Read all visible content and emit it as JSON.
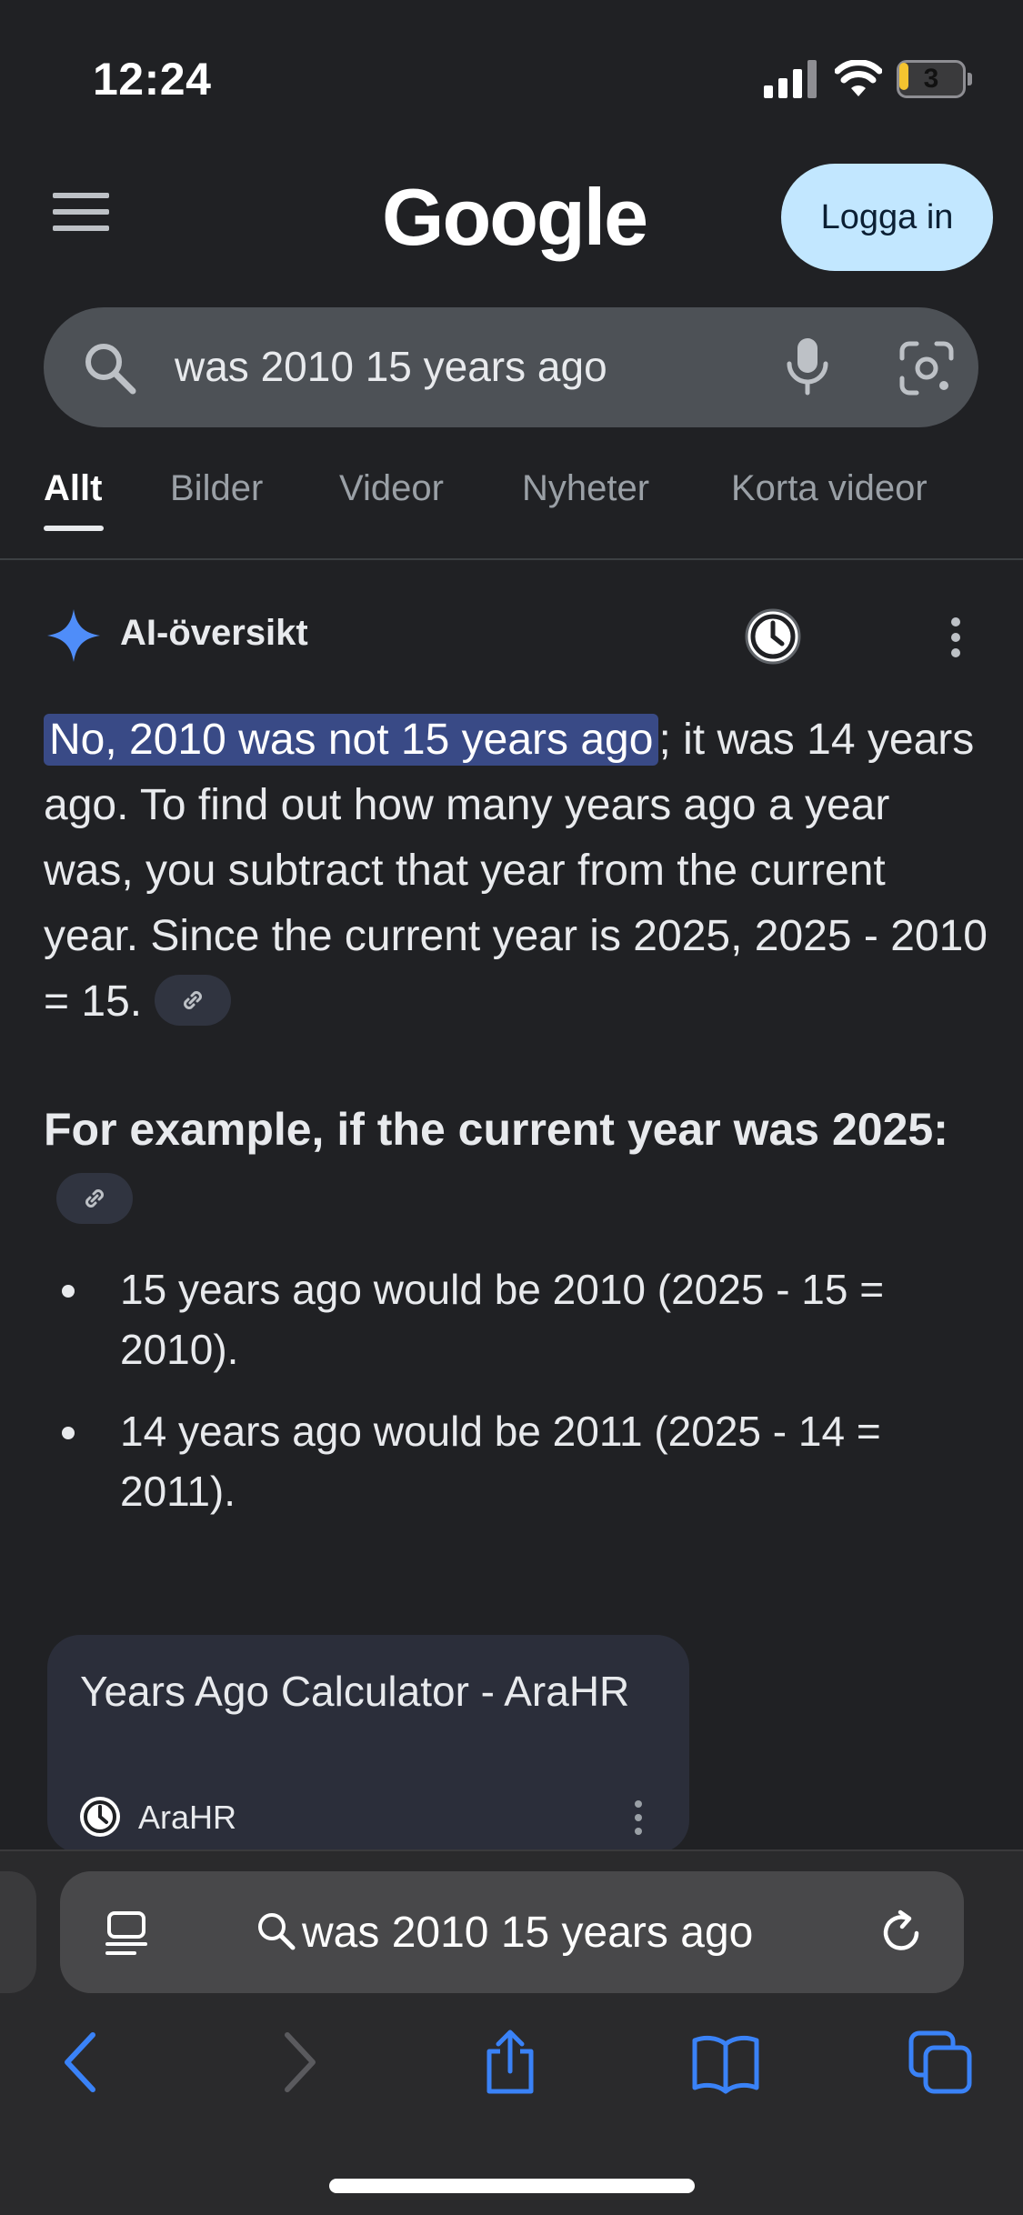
{
  "status_bar": {
    "time": "12:24",
    "battery_level": "3",
    "battery_color": "#f4c430"
  },
  "header": {
    "logo": "Google",
    "login_label": "Logga in",
    "login_color": "#c2e7ff"
  },
  "search": {
    "query": "was 2010 15 years ago",
    "icons": [
      "search-icon",
      "mic-icon",
      "lens-icon"
    ]
  },
  "tabs": [
    {
      "label": "Allt",
      "active": true
    },
    {
      "label": "Bilder",
      "active": false
    },
    {
      "label": "Videor",
      "active": false
    },
    {
      "label": "Nyheter",
      "active": false
    },
    {
      "label": "Korta videor",
      "active": false
    }
  ],
  "ai_overview": {
    "title": "AI-översikt",
    "highlight": "No, 2010 was not 15 years ago",
    "answer_rest": "; it was 14 years ago. To find out how many years ago a year was, you subtract that year from the current year. Since the current year is 2025, 2025 - 2010 = 15.",
    "example_heading": "For example, if the current year was 2025:",
    "bullets": [
      "15 years ago would be 2010 (2025 - 15 = 2010).",
      "14 years ago would be 2011 (2025 - 14 = 2011)."
    ],
    "accent_color": "#4f8df9",
    "highlight_color": "#394a86"
  },
  "source_card": {
    "title": "Years Ago Calculator - AraHR",
    "site": "AraHR"
  },
  "browser": {
    "address_text": "was 2010 15 years ago",
    "accent_color": "#3a82f7",
    "icons": [
      "reader-icon",
      "reload-icon",
      "back-icon",
      "forward-icon",
      "share-icon",
      "bookmarks-icon",
      "tabs-icon"
    ]
  }
}
